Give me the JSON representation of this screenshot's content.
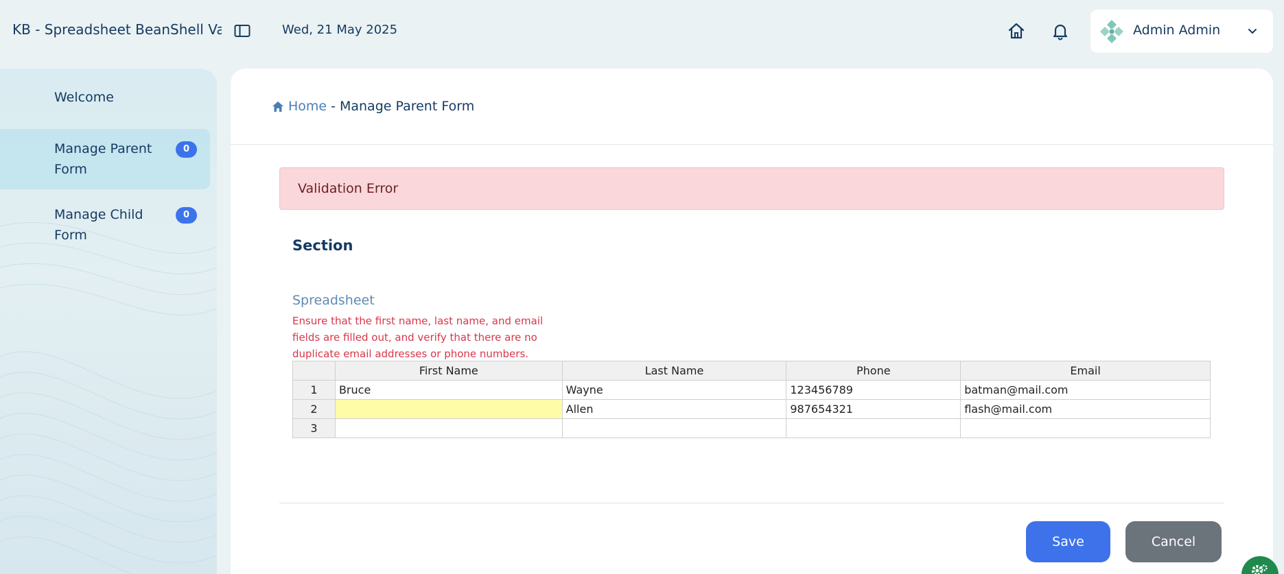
{
  "header": {
    "app_title": "KB - Spreadsheet BeanShell Validation",
    "date": "Wed, 21 May 2025",
    "user_name": "Admin Admin"
  },
  "sidebar": {
    "items": [
      {
        "label": "Welcome",
        "badge": null,
        "active": false
      },
      {
        "label": "Manage Parent Form",
        "badge": "0",
        "active": true
      },
      {
        "label": "Manage Child Form",
        "badge": "0",
        "active": false
      }
    ]
  },
  "breadcrumb": {
    "home": "Home",
    "separator": "-",
    "current": "Manage Parent Form"
  },
  "alert": {
    "text": "Validation Error"
  },
  "section": {
    "title": "Section"
  },
  "spreadsheet": {
    "label": "Spreadsheet",
    "error": "Ensure that the first name, last name, and email fields are filled out, and verify that there are no duplicate email addresses or phone numbers.",
    "columns": [
      "First Name",
      "Last Name",
      "Phone",
      "Email"
    ],
    "rows": [
      {
        "num": "1",
        "first": "Bruce",
        "last": "Wayne",
        "phone": "123456789",
        "email": "batman@mail.com"
      },
      {
        "num": "2",
        "first": "",
        "last": "Allen",
        "phone": "987654321",
        "email": "flash@mail.com"
      },
      {
        "num": "3",
        "first": "",
        "last": "",
        "phone": "",
        "email": ""
      }
    ]
  },
  "actions": {
    "save": "Save",
    "cancel": "Cancel"
  },
  "colors": {
    "primary": "#3e72ea",
    "secondary": "#6b737b",
    "alert_bg": "#f9d7da",
    "error_text": "#d9364a",
    "invalid_cell": "#fffca8"
  }
}
